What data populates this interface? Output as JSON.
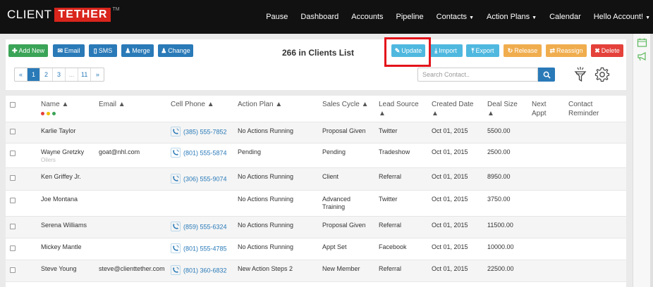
{
  "app": {
    "logo_client": "CLIENT",
    "logo_tether": "TETHER",
    "logo_tm": "TM"
  },
  "nav": {
    "items": [
      "Pause",
      "Dashboard",
      "Accounts",
      "Pipeline"
    ],
    "contacts": "Contacts",
    "action_plans": "Action Plans",
    "calendar": "Calendar",
    "account": "Hello Account!"
  },
  "toolbar": {
    "add_new": "Add New",
    "email": "Email",
    "sms": "SMS",
    "merge": "Merge",
    "change": "Change",
    "count_label": "266 in Clients List",
    "update": "Update",
    "import": "Import",
    "export": "Export",
    "release": "Release",
    "reassign": "Reassign",
    "delete": "Delete"
  },
  "pagination": {
    "prev": "«",
    "pages": [
      "1",
      "2",
      "3",
      "...",
      "11"
    ],
    "next": "»"
  },
  "search": {
    "placeholder": "Search Contact.."
  },
  "table": {
    "headers": {
      "name": "Name ▲",
      "email": "Email ▲",
      "cell_phone": "Cell Phone ▲",
      "action_plan": "Action Plan ▲",
      "sales_cycle": "Sales Cycle ▲",
      "lead_source_1": "Lead Source",
      "lead_source_2": "▲",
      "created_date_1": "Created Date",
      "created_date_2": "▲",
      "deal_size_1": "Deal Size",
      "deal_size_2": "▲",
      "next_appt_1": "Next",
      "next_appt_2": "Appt",
      "contact_reminder_1": "Contact",
      "contact_reminder_2": "Reminder"
    },
    "rows": [
      {
        "name": "Karlie Taylor",
        "sub": "",
        "email": "",
        "phone": "(385) 555-7852",
        "action_plan": "No Actions Running",
        "sales_cycle": "Proposal Given",
        "sales_cycle_2": "",
        "lead_source": "Twitter",
        "created": "Oct 01, 2015",
        "deal": "5500.00"
      },
      {
        "name": "Wayne Gretzky",
        "sub": "Oilers",
        "email": "goat@nhl.com",
        "phone": "(801) 555-5874",
        "action_plan": "Pending",
        "sales_cycle": "Pending",
        "sales_cycle_2": "",
        "lead_source": "Tradeshow",
        "created": "Oct 01, 2015",
        "deal": "2500.00"
      },
      {
        "name": "Ken Griffey Jr.",
        "sub": "",
        "email": "",
        "phone": "(306) 555-9074",
        "action_plan": "No Actions Running",
        "sales_cycle": "Client",
        "sales_cycle_2": "",
        "lead_source": "Referral",
        "created": "Oct 01, 2015",
        "deal": "8950.00"
      },
      {
        "name": "Joe Montana",
        "sub": "",
        "email": "",
        "phone": "",
        "action_plan": "No Actions Running",
        "sales_cycle": "Advanced",
        "sales_cycle_2": "Training",
        "lead_source": "Twitter",
        "created": "Oct 01, 2015",
        "deal": "3750.00"
      },
      {
        "name": "Serena Williams",
        "sub": "",
        "email": "",
        "phone": "(859) 555-6324",
        "action_plan": "No Actions Running",
        "sales_cycle": "Proposal Given",
        "sales_cycle_2": "",
        "lead_source": "Referral",
        "created": "Oct 01, 2015",
        "deal": "11500.00"
      },
      {
        "name": "Mickey Mantle",
        "sub": "",
        "email": "",
        "phone": "(801) 555-4785",
        "action_plan": "No Actions Running",
        "sales_cycle": "Appt Set",
        "sales_cycle_2": "",
        "lead_source": "Facebook",
        "created": "Oct 01, 2015",
        "deal": "10000.00"
      },
      {
        "name": "Steve Young",
        "sub": "",
        "email": "steve@clienttether.com",
        "phone": "(801) 360-6832",
        "action_plan": "New Action Steps 2",
        "sales_cycle": "New Member",
        "sales_cycle_2": "",
        "lead_source": "Referral",
        "created": "Oct 01, 2015",
        "deal": "22500.00"
      }
    ]
  },
  "colors": {
    "green": "#3aa457",
    "blue": "#2a7ab8",
    "cyan": "#4fb8df",
    "orange": "#f0ad4e",
    "red": "#e4413a",
    "highlight": "#e3141b"
  },
  "icons": {
    "add": "plus-icon",
    "email": "envelope-icon",
    "sms": "phone-icon",
    "merge": "user-icon",
    "change": "user-icon",
    "update": "edit-icon",
    "import": "import-icon",
    "export": "export-icon",
    "release": "refresh-icon",
    "reassign": "reassign-icon",
    "delete": "close-icon",
    "search": "search-icon",
    "filter": "filter-icon",
    "settings": "gear-icon",
    "cell": "call-icon"
  }
}
